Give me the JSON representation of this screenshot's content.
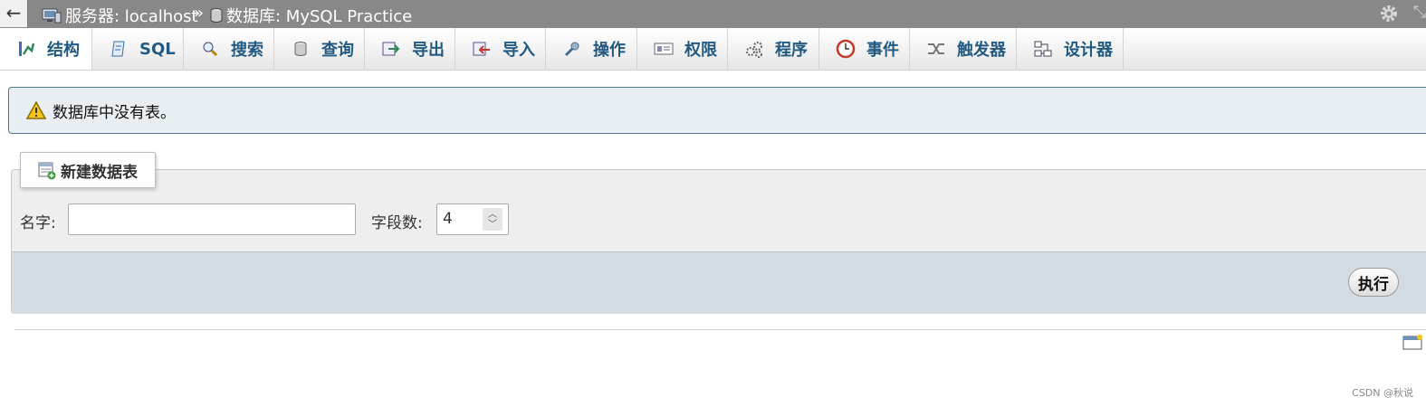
{
  "breadcrumb": {
    "server_label": "服务器: localhost",
    "separator": "»",
    "database_label": "数据库: MySQL Practice"
  },
  "tabs": [
    {
      "label": "结构",
      "icon": "structure-icon",
      "active": true
    },
    {
      "label": "SQL",
      "icon": "sql-icon"
    },
    {
      "label": "搜索",
      "icon": "search-icon"
    },
    {
      "label": "查询",
      "icon": "query-icon"
    },
    {
      "label": "导出",
      "icon": "export-icon"
    },
    {
      "label": "导入",
      "icon": "import-icon"
    },
    {
      "label": "操作",
      "icon": "wrench-icon"
    },
    {
      "label": "权限",
      "icon": "privileges-icon"
    },
    {
      "label": "程序",
      "icon": "routines-icon"
    },
    {
      "label": "事件",
      "icon": "events-clock-icon"
    },
    {
      "label": "触发器",
      "icon": "triggers-icon"
    },
    {
      "label": "设计器",
      "icon": "designer-icon"
    }
  ],
  "notice": {
    "text": "数据库中没有表。",
    "icon": "warning-icon"
  },
  "create_table": {
    "legend": "新建数据表",
    "name_label": "名字:",
    "name_value": "",
    "columns_label": "字段数:",
    "columns_value": "4",
    "go_label": "执行"
  },
  "watermark": "CSDN @秋说",
  "colors": {
    "tab_text": "#235a81",
    "topbar": "#888888",
    "notice_bg": "#e8eef1",
    "footer_bg": "#d3dbe3"
  }
}
